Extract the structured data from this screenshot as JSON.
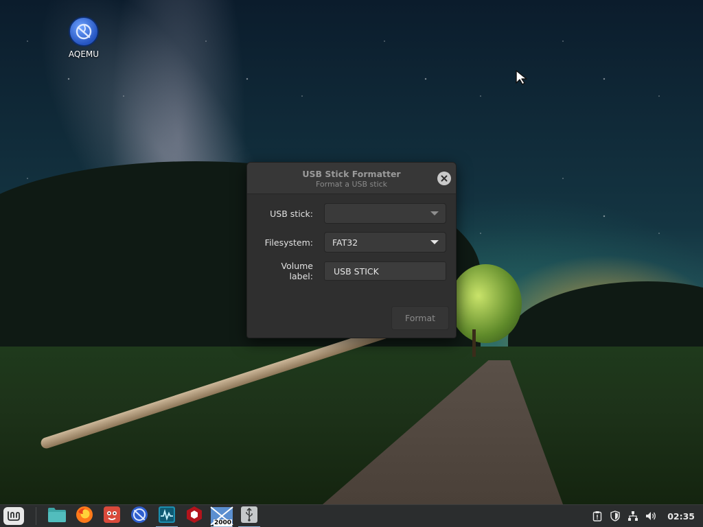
{
  "desktop": {
    "icons": [
      {
        "label": "AQEMU",
        "icon": "qemu-icon"
      }
    ]
  },
  "dialog": {
    "title": "USB Stick Formatter",
    "subtitle": "Format a USB stick",
    "fields": {
      "usb_stick": {
        "label": "USB stick:",
        "value": ""
      },
      "filesystem": {
        "label": "Filesystem:",
        "value": "FAT32"
      },
      "volume_label": {
        "label": "Volume label:",
        "value": "USB STICK"
      }
    },
    "format_label": "Format"
  },
  "taskbar": {
    "menu_icon": "linux-mint-logo",
    "launchers": [
      {
        "name": "files",
        "icon": "folder-icon",
        "running": false
      },
      {
        "name": "firefox",
        "icon": "firefox-icon",
        "running": false
      },
      {
        "name": "gimp",
        "icon": "gimp-icon",
        "running": false
      },
      {
        "name": "aqemu",
        "icon": "qemu-icon",
        "running": false
      },
      {
        "name": "system-monitor",
        "icon": "system-monitor-icon",
        "running": true
      },
      {
        "name": "ruby-app",
        "icon": "ruby-hexagon-icon",
        "running": false
      },
      {
        "name": "windows-2000",
        "icon": "windows-2000-icon",
        "running": true,
        "badge": "2000"
      },
      {
        "name": "usb-stick-formatter",
        "icon": "usb-icon",
        "running": true
      }
    ],
    "tray": {
      "icons": [
        "clipboard-icon",
        "shield-icon",
        "network-icon",
        "volume-icon"
      ],
      "clock": "02:35"
    }
  },
  "colors": {
    "taskbar_bg": "#2b2d2e",
    "dialog_bg": "#2f2f2f",
    "dialog_titlebar": "#373737",
    "running_indicator": "#8fb7d8"
  }
}
